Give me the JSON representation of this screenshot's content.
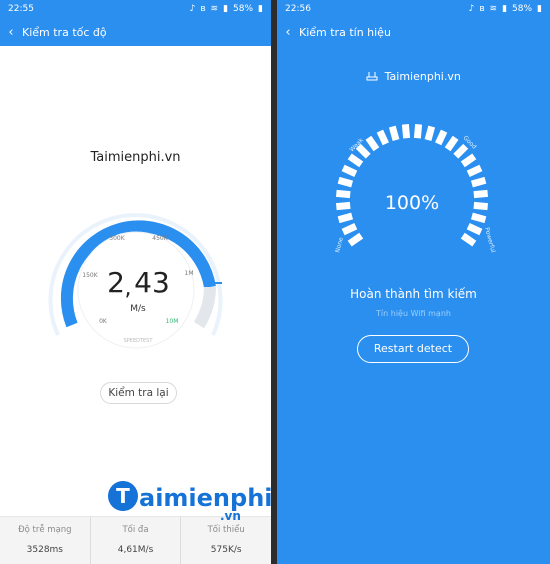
{
  "left": {
    "status": {
      "time": "22:55",
      "battery": "58%"
    },
    "title": "Kiểm tra tốc độ",
    "brand": "Taimienphi.vn",
    "gauge": {
      "value_whole": "2",
      "value_comma": ",",
      "value_frac": "43",
      "unit": "M/s",
      "tick_labels": [
        "0K",
        "150K",
        "300K",
        "450K",
        "1M",
        "10M"
      ],
      "footer": "SPEEDTEST"
    },
    "retest_button": "Kiểm tra lại",
    "stats": [
      {
        "label": "Độ trễ mạng",
        "value": "3528ms"
      },
      {
        "label": "Tối đa",
        "value": "4,61M/s"
      },
      {
        "label": "Tối thiểu",
        "value": "575K/s"
      }
    ]
  },
  "watermark": {
    "main": "aimienphi",
    "suffix": ".vn"
  },
  "right": {
    "status": {
      "time": "22:56",
      "battery": "58%"
    },
    "title": "Kiểm tra tín hiệu",
    "brand": "Taimienphi.vn",
    "signal": {
      "percent": "100%",
      "labels": [
        "None",
        "Weak",
        "Good",
        "Powerful"
      ],
      "level": 1.0
    },
    "done_text": "Hoàn thành tìm kiếm",
    "sub_text": "Tín hiệu Wifi mạnh",
    "restart_button": "Restart detect"
  },
  "colors": {
    "accent": "#2b8ff0",
    "green": "#2eb872"
  }
}
